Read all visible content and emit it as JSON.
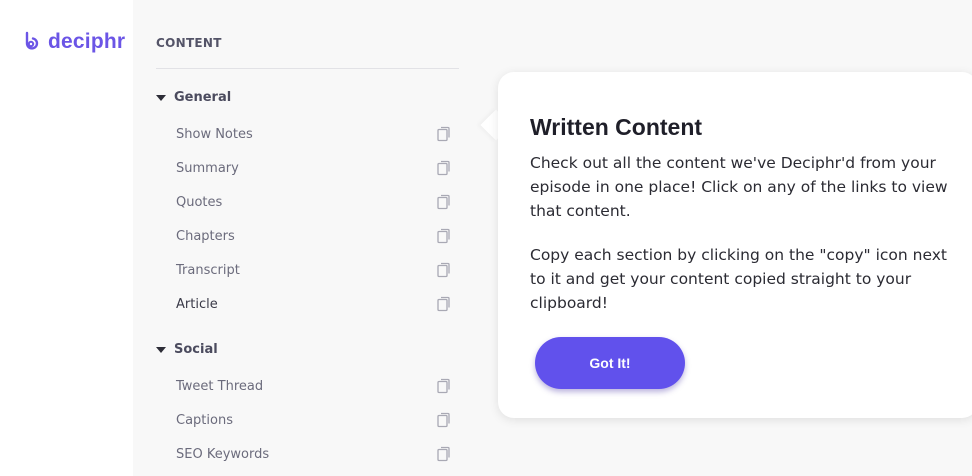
{
  "brand": {
    "name": "deciphr",
    "color": "#6b55e6"
  },
  "sidebar": {
    "heading": "CONTENT",
    "sections": [
      {
        "title": "General",
        "items": [
          {
            "label": "Show Notes"
          },
          {
            "label": "Summary"
          },
          {
            "label": "Quotes"
          },
          {
            "label": "Chapters"
          },
          {
            "label": "Transcript"
          },
          {
            "label": "Article"
          }
        ]
      },
      {
        "title": "Social",
        "items": [
          {
            "label": "Tweet Thread"
          },
          {
            "label": "Captions"
          },
          {
            "label": "SEO Keywords"
          }
        ]
      }
    ],
    "item_icon": "copy-icon"
  },
  "popover": {
    "title": "Written Content",
    "paragraph_1": "Check out all the content we've Deciphr'd from your episode in one place! Click on any of the links to view that content.",
    "paragraph_2": "Copy each section by clicking on the \"copy\" icon next to it and get your content copied straight to your clipboard!",
    "button_label": "Got It!",
    "button_color": "#6151ec"
  }
}
